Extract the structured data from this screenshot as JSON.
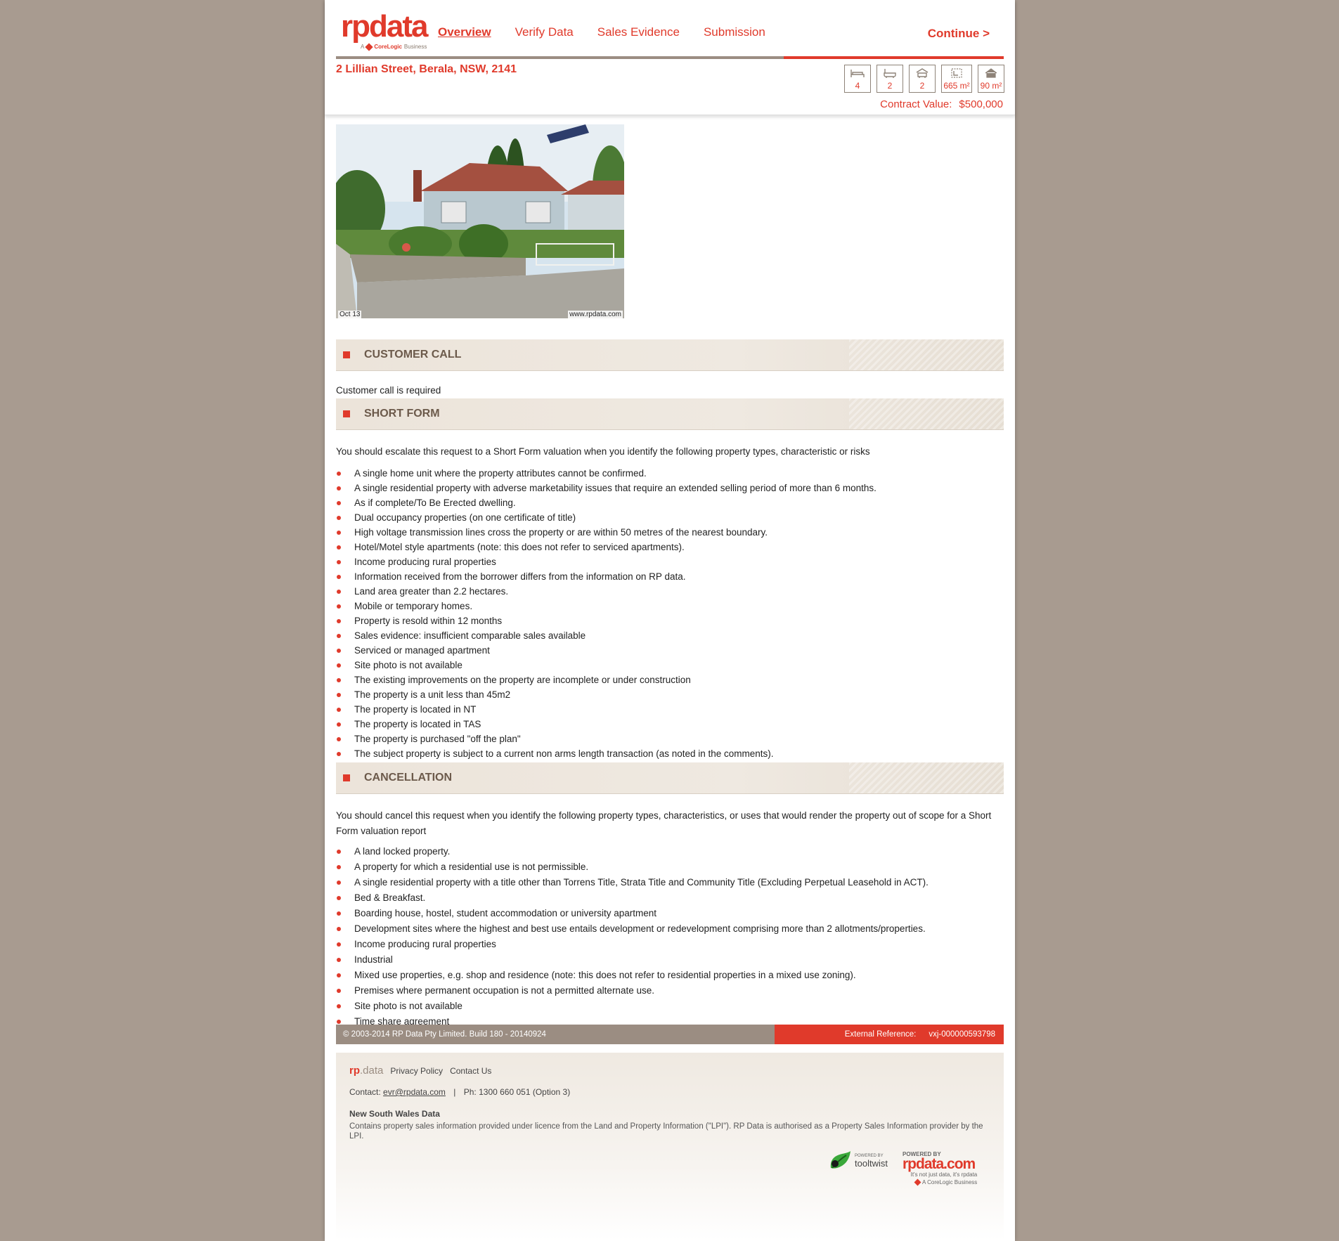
{
  "brand": {
    "logo_text": "rpdata",
    "logo_sub_prefix": "A",
    "logo_sub_brand": "CoreLogic",
    "logo_sub_suffix": "Business"
  },
  "nav": {
    "items": [
      "Overview",
      "Verify Data",
      "Sales Evidence",
      "Submission"
    ],
    "active": "Overview",
    "continue_label": "Continue >"
  },
  "progress_fraction": 0.33,
  "property": {
    "address": "2 Lillian Street, Berala, NSW, 2141",
    "attributes": [
      {
        "icon": "bed-icon",
        "value": "4"
      },
      {
        "icon": "bath-icon",
        "value": "2"
      },
      {
        "icon": "car-icon",
        "value": "2"
      },
      {
        "icon": "land-area-icon",
        "value": "665 m²"
      },
      {
        "icon": "house-area-icon",
        "value": "90 m²"
      }
    ],
    "contract_label": "Contract Value:",
    "contract_value": "$500,000",
    "photo_caption_left": "Oct 13",
    "photo_caption_right": "www.rpdata.com"
  },
  "sections": {
    "customer_call": {
      "title": "CUSTOMER CALL",
      "text": "Customer call is required"
    },
    "short_form": {
      "title": "SHORT FORM",
      "intro": "You should escalate this request to a Short Form valuation when you identify the following property types, characteristic or risks",
      "items": [
        "A single home unit where the property attributes cannot be confirmed.",
        "A single residential property with adverse marketability issues that require an extended selling period of more than 6 months.",
        "As if complete/To Be Erected dwelling.",
        "Dual occupancy properties (on one certificate of title)",
        "High voltage transmission lines cross the property or are within 50 metres of the nearest boundary.",
        "Hotel/Motel style apartments (note: this does not refer to serviced apartments).",
        "Income producing rural properties",
        "Information received from the borrower differs from the information on RP data.",
        "Land area greater than 2.2 hectares.",
        "Mobile or temporary homes.",
        "Property is resold within 12 months",
        "Sales evidence: insufficient comparable sales available",
        "Serviced or managed apartment",
        "Site photo is not available",
        "The existing improvements on the property are incomplete or under construction",
        "The property is a unit less than 45m2",
        "The property is located in NT",
        "The property is located in TAS",
        "The property is purchased \"off the plan\"",
        "The subject property is subject to a current non arms length transaction (as noted in the comments)."
      ]
    },
    "cancellation": {
      "title": "CANCELLATION",
      "intro": "You should cancel this request when you identify the following property types, characteristics, or uses that would render the property out of scope for a Short Form valuation report",
      "items": [
        "A land locked property.",
        "A property for which a residential use is not permissible.",
        "A single residential property with a title other than Torrens Title, Strata Title and Community Title (Excluding Perpetual Leasehold in ACT).",
        "Bed & Breakfast.",
        "Boarding house, hostel, student accommodation or university apartment",
        "Development sites where the highest and best use entails development or redevelopment comprising more than 2 allotments/properties.",
        "Income producing rural properties",
        "Industrial",
        "Mixed use properties, e.g. shop and residence (note: this does not refer to residential properties in a mixed use zoning).",
        "Premises where permanent occupation is not a permitted alternate use.",
        "Site photo is not available",
        "Time share agreement"
      ]
    }
  },
  "statusbar": {
    "copyright": "© 2003-2014 RP Data Pty Limited.  Build 180 - 20140924",
    "ext_ref_label": "External Reference:",
    "ext_ref_value": "vxj-000000593798"
  },
  "footer": {
    "logo_rp": "rp",
    "logo_data": ".data",
    "privacy": "Privacy Policy",
    "contact_us": "Contact Us",
    "contact_label": "Contact:",
    "email": "evr@rpdata.com",
    "phone": "Ph: 1300 660 051 (Option 3)",
    "nsw_title": "New South Wales Data",
    "licence": "Contains property sales information provided under licence from the Land and Property Information (\"LPI\"). RP Data is authorised as a Property Sales Information provider by the LPI.",
    "tooltwist_powered": "POWERED BY",
    "tooltwist_name": "tooltwist",
    "rpdatacom_powered": "POWERED BY",
    "rpdatacom_name": "rpdata.com",
    "rpdatacom_tagline": "It's not just data, it's rpdata",
    "rpdatacom_cl": "A CoreLogic Business"
  },
  "colors": {
    "accent": "#e03a2b",
    "taupe": "#9b8d82",
    "background": "#a89b90"
  }
}
